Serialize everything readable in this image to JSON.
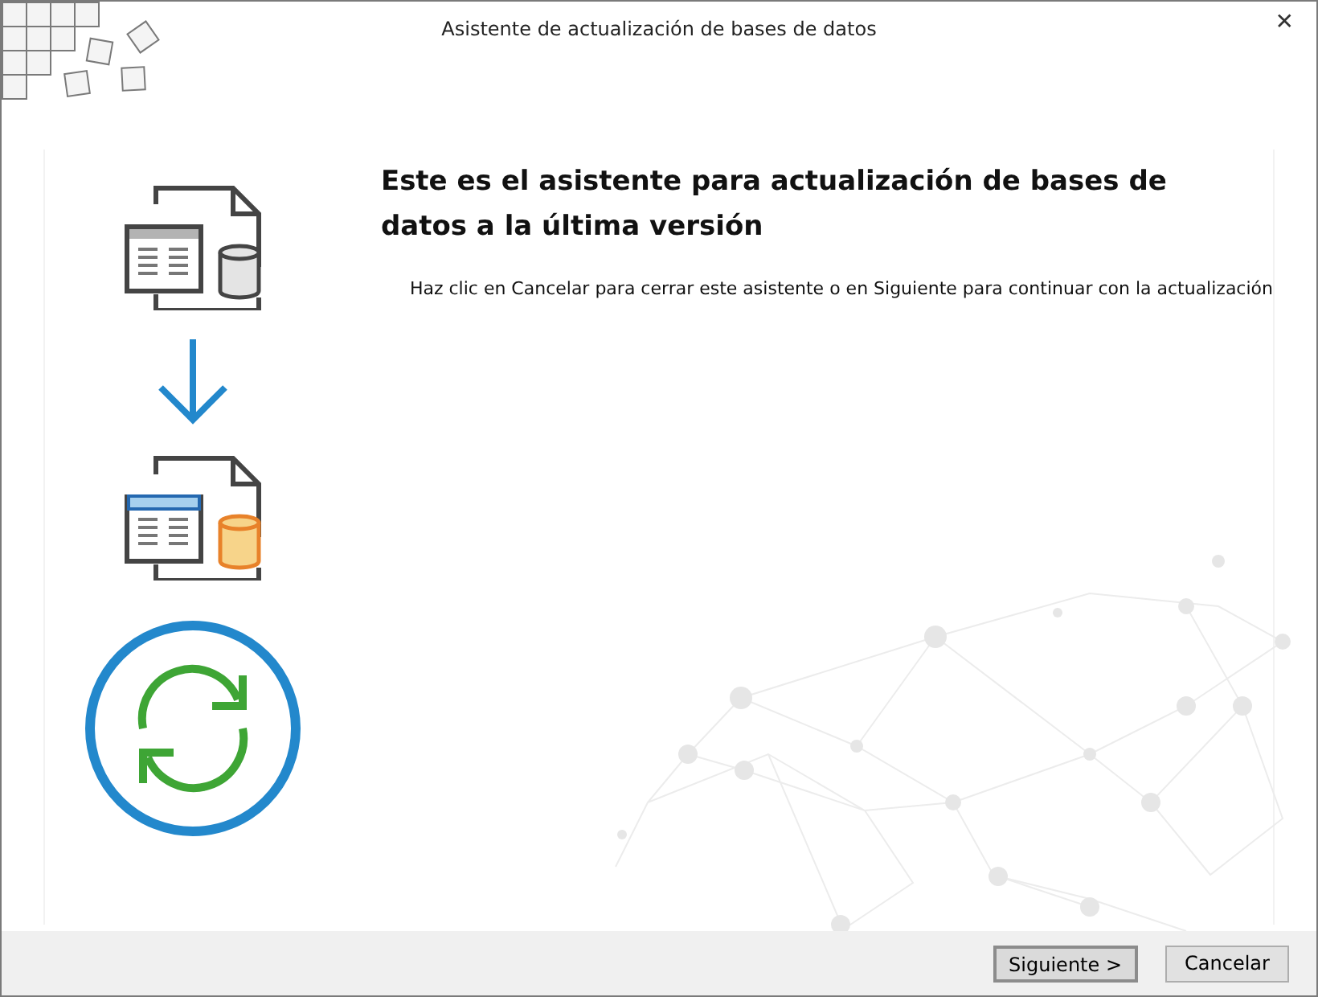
{
  "window": {
    "title": "Asistente de actualización de bases de datos",
    "close": "✕"
  },
  "heading": "Este es el asistente para actualización de bases de datos a la última versión",
  "instruction": "Haz clic en Cancelar para cerrar este asistente o en Siguiente para continuar con la actualización",
  "buttons": [
    {
      "label": "Siguiente >",
      "focused": true
    },
    {
      "label": "Cancelar",
      "focused": false
    }
  ]
}
